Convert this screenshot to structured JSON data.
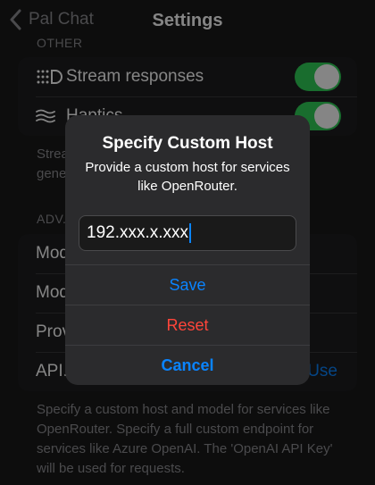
{
  "nav": {
    "back_label": "Pal Chat",
    "title": "Settings"
  },
  "sections": {
    "other_header": "OTHER",
    "other_rows": [
      {
        "label": "Stream responses",
        "enabled": true,
        "icon": "stream-icon"
      },
      {
        "label": "Haptics",
        "enabled": true,
        "icon": "waves-icon"
      }
    ],
    "other_footer": "Strea... gene...",
    "advanced_header": "ADV...",
    "advanced_rows": [
      {
        "label": "Mod..."
      },
      {
        "label": "Mod..."
      },
      {
        "label": "Prov..."
      },
      {
        "label": "API...",
        "action": "Use"
      }
    ],
    "advanced_footer": "Specify a custom host and model for services like OpenRouter. Specify a full custom endpoint for services like Azure OpenAI. The 'OpenAI API Key' will be used for requests."
  },
  "alert": {
    "title": "Specify Custom Host",
    "message": "Provide a custom host for services like OpenRouter.",
    "input_value": "192.xxx.x.xxx",
    "buttons": {
      "save": "Save",
      "reset": "Reset",
      "cancel": "Cancel"
    }
  },
  "colors": {
    "accent": "#0a84ff",
    "destructive": "#ff453a",
    "toggle_on": "#30d158"
  }
}
